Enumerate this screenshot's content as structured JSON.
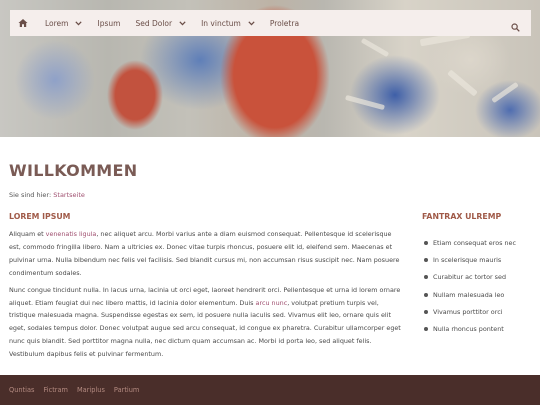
{
  "nav": {
    "items": [
      {
        "label": "Lorem",
        "has_dropdown": true
      },
      {
        "label": "Ipsum",
        "has_dropdown": false
      },
      {
        "label": "Sed Dolor",
        "has_dropdown": true
      },
      {
        "label": "In vinctum",
        "has_dropdown": true
      },
      {
        "label": "Proletra",
        "has_dropdown": false
      }
    ],
    "home_icon": "home-icon",
    "search_icon": "search-icon"
  },
  "page": {
    "title": "WILLKOMMEN",
    "breadcrumb_prefix": "Sie sind hier:",
    "breadcrumb_link": "Startseite"
  },
  "main": {
    "section_title": "LOREM IPSUM",
    "para1": {
      "before_link": "Aliquam et ",
      "link": "venenatis ligula",
      "after_link": ", nec aliquet arcu. Morbi varius ante a diam euismod consequat. Pellentesque id scelerisque est, commodo fringilla libero. Nam a ultricies ex. Donec vitae turpis rhoncus, posuere elit id, eleifend sem. Maecenas et pulvinar urna. Nulla bibendum nec felis vel facilisis. Sed blandit cursus mi, non accumsan risus suscipit nec. Nam posuere condimentum sodales."
    },
    "para2": {
      "before_link": "Nunc congue tincidunt nulla. In lacus urna, lacinia ut orci eget, laoreet hendrerit orci. Pellentesque et urna id lorem ornare aliquet. Etiam feugiat dui nec libero mattis, id lacinia dolor elementum. Duis ",
      "link": "arcu nunc",
      "after_link": ", volutpat pretium turpis vel, tristique malesuada magna. Suspendisse egestas ex sem, id posuere nulla iaculis sed. Vivamus elit leo, ornare quis elit eget, sodales tempus dolor. Donec volutpat augue sed arcu consequat, id congue ex pharetra. Curabitur ullamcorper eget nunc quis blandit. Sed porttitor magna nulla, nec dictum quam accumsan ac. Morbi id porta leo, sed aliquet felis. Vestibulum dapibus felis et pulvinar fermentum."
    }
  },
  "sidebar": {
    "title": "FANTRAX ULREMP",
    "items": [
      "Etiam consequat eros nec",
      "In scelerisque mauris",
      "Curabitur ac tortor sed",
      "Nullam malesuada leo",
      "Vivamus porttitor orci",
      "Nulla rhoncus pontent"
    ]
  },
  "footer": {
    "links": [
      "Quntias",
      "Fictram",
      "Mariplus",
      "Partium"
    ]
  },
  "colors": {
    "accent": "#a05a48",
    "link": "#a05070",
    "footer_bg": "#4a2e2a",
    "nav_bg": "#f5eeec"
  }
}
